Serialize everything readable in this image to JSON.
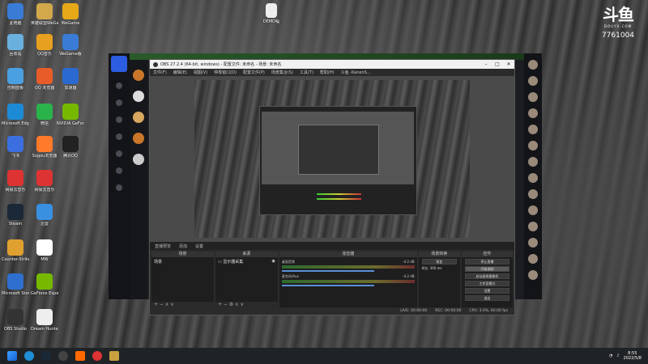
{
  "desktop": {
    "icons": [
      {
        "label": "此电脑"
      },
      {
        "label": "英雄联盟WeGame"
      },
      {
        "label": "WeGame"
      },
      {
        "label": "回收站"
      },
      {
        "label": "QQ音乐"
      },
      {
        "label": "WeGame版"
      },
      {
        "label": "控制面板"
      },
      {
        "label": "QQ 浏览器"
      },
      {
        "label": "加速器"
      },
      {
        "label": "Microsoft Edge"
      },
      {
        "label": "微信"
      },
      {
        "label": "NVIDIA GeForce"
      },
      {
        "label": "飞书"
      },
      {
        "label": "Sogou浏览器"
      },
      {
        "label": "腾讯QQ"
      },
      {
        "label": "网易云音乐"
      },
      {
        "label": "网易云音乐"
      },
      {
        "label": "Steam"
      },
      {
        "label": "迅雷"
      },
      {
        "label": "Counter-Strike: Global Offensive"
      },
      {
        "label": "MW"
      },
      {
        "label": "Microsoft Store"
      },
      {
        "label": "GeForce Experience"
      },
      {
        "label": "OBS Studio"
      },
      {
        "label": "Dream Hunter"
      }
    ],
    "desktop_file_label": "DEMO幅"
  },
  "watermark": {
    "logo": "斗鱼",
    "site": "DOUYU.COM",
    "room": "7761004"
  },
  "obs": {
    "title": "OBS 27.2.4 (64-bit, windows) - 配置文件: 未命名 - 场景: 未命名",
    "menu": [
      "文件(F)",
      "编辑(E)",
      "视图(V)",
      "停靠窗口(D)",
      "配置文件(P)",
      "场景集合(S)",
      "工具(T)",
      "帮助(H)",
      "斗鱼 -KanenS..."
    ],
    "scene_bar": {
      "label": "直播预览",
      "btn1": "添加",
      "btn2": "设置"
    },
    "docks": {
      "scenes": {
        "header": "场景",
        "items": [
          "场景"
        ]
      },
      "sources": {
        "header": "来源",
        "items": [
          "显示器采集"
        ]
      },
      "mixer": {
        "header": "混音器",
        "tracks": [
          {
            "name": "桌面音频",
            "db": "-4.2 dB"
          },
          {
            "name": "麦克风/Aux",
            "db": "-4.2 dB"
          }
        ]
      },
      "transitions": {
        "header": "场景转换",
        "mode": "渐变",
        "duration_label": "时长",
        "duration": "300 ms"
      },
      "controls": {
        "header": "控件",
        "buttons": [
          "停止直播",
          "开始录制",
          "启动虚拟摄像机",
          "工作室模式",
          "设置",
          "退出"
        ]
      }
    },
    "status": {
      "live": "LIVE: 00:00:00",
      "rec": "REC: 00:00:00",
      "cpu": "CPU: 3.0%, 60.00 fps"
    }
  },
  "taskbar": {
    "time": "8:55",
    "date": "2022/5/8"
  },
  "colors": {
    "obs_bg": "#2b2b2b",
    "douyu_blue": "#2c5de0",
    "taskbar": "#202326"
  }
}
